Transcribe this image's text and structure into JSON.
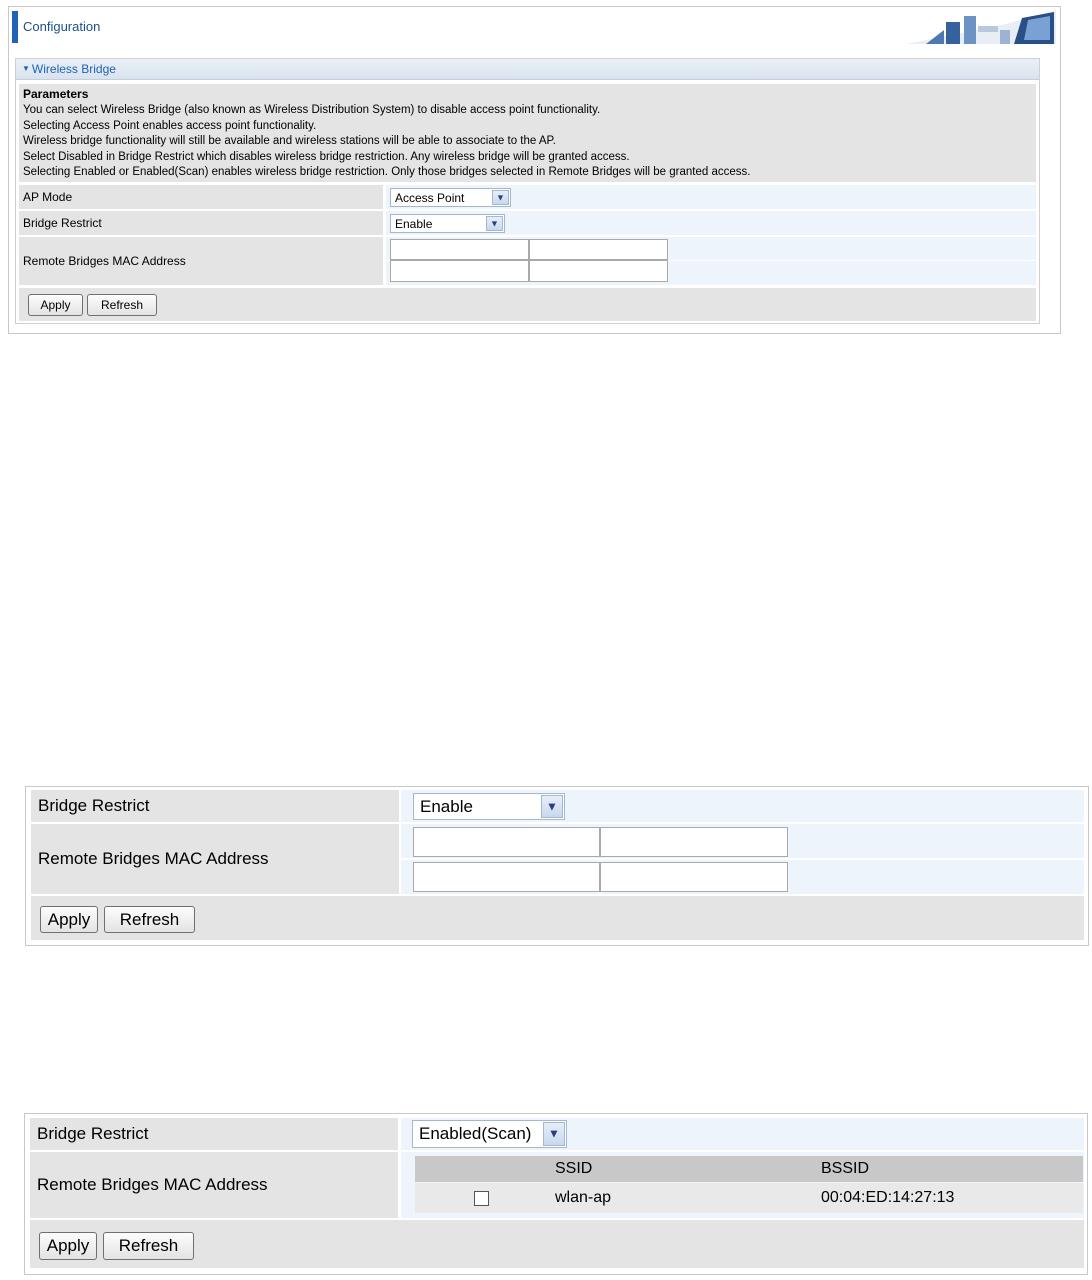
{
  "header": {
    "title": "Configuration"
  },
  "section": {
    "title": "Wireless Bridge"
  },
  "parameters": {
    "title": "Parameters",
    "lines": [
      "You can select Wireless Bridge (also known as Wireless Distribution System) to disable access point functionality.",
      "Selecting Access Point enables access point functionality.",
      "Wireless bridge functionality will still be available and wireless stations will be able to associate to the AP.",
      "Select Disabled in Bridge Restrict which disables wireless bridge restriction. Any wireless bridge will be granted access.",
      "Selecting Enabled or Enabled(Scan) enables wireless bridge restriction. Only those bridges selected in Remote Bridges will be granted access."
    ]
  },
  "form": {
    "ap_mode_label": "AP Mode",
    "ap_mode_value": "Access Point",
    "bridge_restrict_label": "Bridge Restrict",
    "bridge_restrict_value": "Enable",
    "remote_mac_label": "Remote Bridges MAC Address",
    "apply_label": "Apply",
    "refresh_label": "Refresh"
  },
  "zoom2": {
    "bridge_restrict_label": "Bridge Restrict",
    "bridge_restrict_value": "Enable",
    "remote_mac_label": "Remote Bridges MAC Address",
    "apply_label": "Apply",
    "refresh_label": "Refresh"
  },
  "zoom3": {
    "bridge_restrict_label": "Bridge Restrict",
    "bridge_restrict_value": "Enabled(Scan)",
    "remote_mac_label": "Remote Bridges MAC Address",
    "table": {
      "headers": [
        "",
        "SSID",
        "BSSID"
      ],
      "rows": [
        {
          "checked": false,
          "ssid": "wlan-ap",
          "bssid": "00:04:ED:14:27:13"
        }
      ]
    },
    "apply_label": "Apply",
    "refresh_label": "Refresh"
  },
  "icons": {
    "dropdown": "chevron-down-icon",
    "section_toggle": "triangle-down-icon",
    "banner": "network-illustration-icon"
  },
  "colors": {
    "accent": "#1e63b4",
    "label_bg": "#e4e4e4",
    "value_bg": "#edf4fb"
  }
}
